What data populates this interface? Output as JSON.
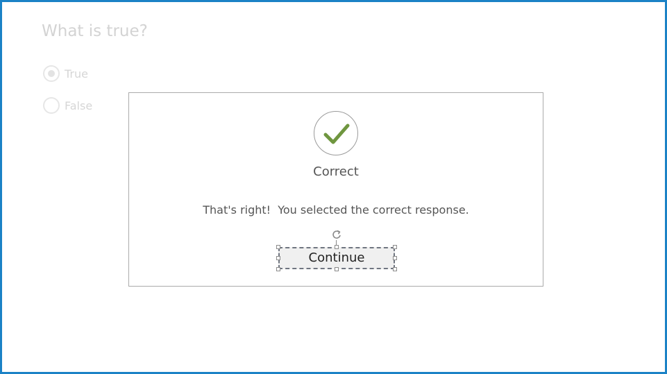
{
  "question": {
    "title": "What is true?",
    "options": [
      {
        "label": "True",
        "selected": true
      },
      {
        "label": "False",
        "selected": false
      }
    ]
  },
  "feedback": {
    "icon": "checkmark-icon",
    "title": "Correct",
    "message": "That's right!  You selected the correct response.",
    "continue_label": "Continue",
    "check_color": "#6f963f"
  },
  "colors": {
    "frame_border": "#1b82c6",
    "dim_text": "#d3d3d3"
  }
}
